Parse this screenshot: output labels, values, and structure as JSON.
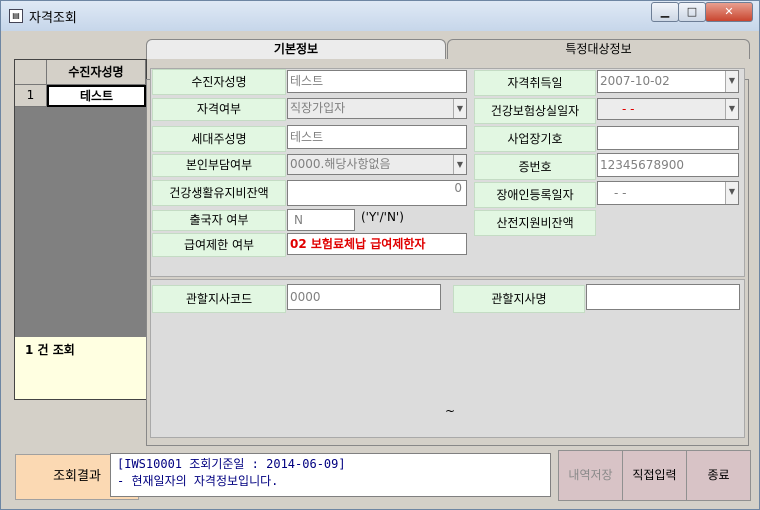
{
  "window": {
    "title": "자격조회",
    "minimize_icon": "minimize-icon",
    "maximize_icon": "maximize-icon",
    "close_icon": "close-icon",
    "min_glyph": "▁",
    "max_glyph": "□",
    "close_glyph": "✕"
  },
  "list": {
    "header": "수진자성명",
    "rows": [
      {
        "num": "1",
        "name": "테스트"
      }
    ],
    "count": "1 건 조회"
  },
  "tabs": [
    "기본정보",
    "특정대상정보"
  ],
  "basic": {
    "name_label": "수진자성명",
    "name_value": "테스트",
    "qualification_label": "자격여부",
    "qualification_value": "직장가입자",
    "householder_label": "세대주성명",
    "householder_value": "테스트",
    "self_pay_label": "본인부담여부",
    "self_pay_value": "0000.해당사항없음",
    "health_balance_label": "건강생활유지비잔액",
    "health_balance_value": "0",
    "departure_label": "출국자 여부",
    "departure_value": "N",
    "departure_hint": "('Y'/'N')",
    "restriction_label": "급여제한 여부",
    "restriction_value": "02 보험료체납 급여제한자",
    "acquired_label": "자격취득일",
    "acquired_value": "2007-10-02",
    "lost_label": "건강보험상실일자",
    "lost_value": "-   -",
    "workplace_label": "사업장기호",
    "workplace_value": "",
    "cert_label": "증번호",
    "cert_value": "12345678900",
    "disability_label": "장애인등록일자",
    "disability_value": "-   -",
    "maternity_label": "산전지원비잔액"
  },
  "office": {
    "code_label": "관할지사코드",
    "code_value": "0000",
    "name_label": "관할지사명",
    "name_value": ""
  },
  "tilde": "~",
  "result": {
    "label": "조회결과",
    "line1": "[IWS10001 조회기준일 : 2014-06-09]",
    "line2": " - 현재일자의 자격정보입니다."
  },
  "buttons": {
    "save": "내역저장",
    "direct": "직접입력",
    "exit": "종료"
  },
  "colors": {
    "restriction_text": "#e00000",
    "label_bg": "#e2f7e2",
    "message_text": "#000080"
  }
}
